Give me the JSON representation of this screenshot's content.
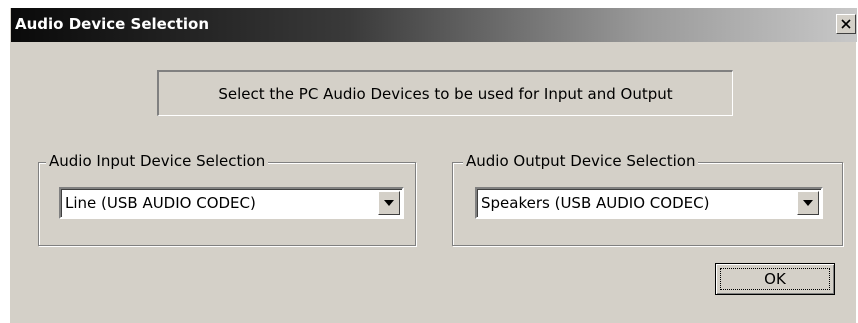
{
  "window": {
    "title": "Audio Device Selection",
    "close_glyph": "✕"
  },
  "info": {
    "text": "Select the PC Audio Devices to be used for Input and Output"
  },
  "input_group": {
    "legend": "Audio Input Device Selection",
    "selected": "Line (USB AUDIO  CODEC)",
    "icon": "chevron-down-icon"
  },
  "output_group": {
    "legend": "Audio Output Device Selection",
    "selected": "Speakers (USB AUDIO  CODEC)",
    "icon": "chevron-down-icon"
  },
  "buttons": {
    "ok_label": "OK"
  },
  "colors": {
    "face": "#d4d0c8",
    "title_start": "#0a0a0a",
    "title_end": "#c8c8c8"
  }
}
